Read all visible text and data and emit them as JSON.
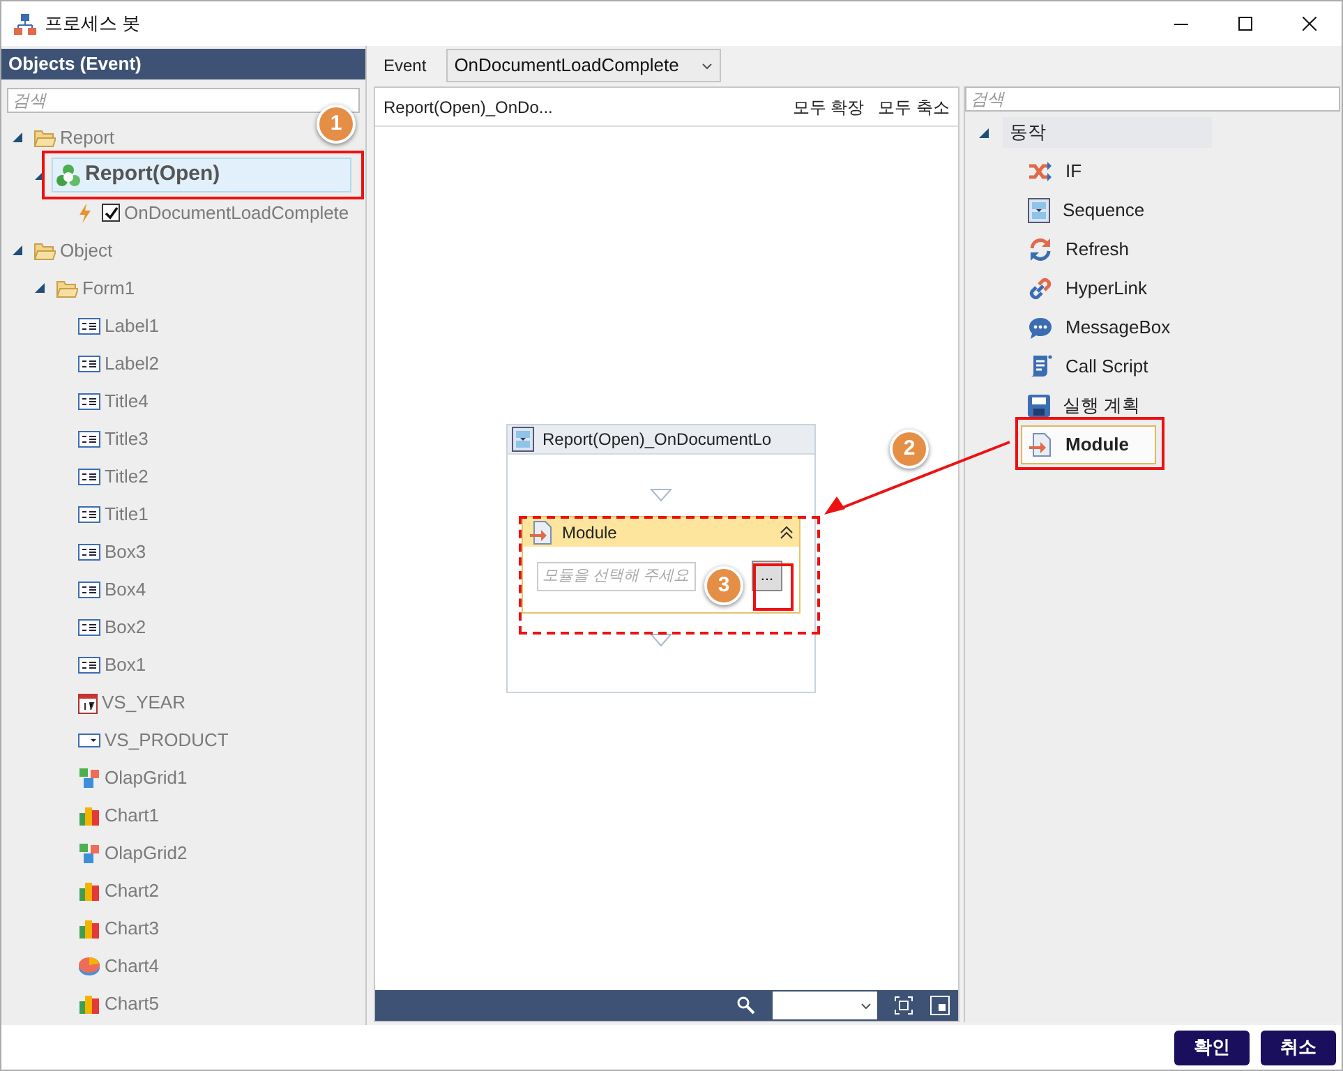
{
  "window": {
    "title": "프로세스 봇"
  },
  "objects_panel": {
    "title": "Objects (Event)",
    "search": {
      "placeholder": "검색"
    },
    "tree": [
      {
        "label": "Report",
        "kind": "folder",
        "expanded": true,
        "selected": false,
        "children": [
          {
            "label": "Report(Open)",
            "kind": "report",
            "expanded": true,
            "selected": true,
            "children": [
              {
                "label": "OnDocumentLoadComplete",
                "kind": "event",
                "checked": true,
                "selected": false
              }
            ]
          }
        ]
      },
      {
        "label": "Object",
        "kind": "folder",
        "expanded": true,
        "selected": false,
        "children": [
          {
            "label": "Form1",
            "kind": "folder",
            "expanded": true,
            "selected": false,
            "children": [
              {
                "label": "Label1",
                "kind": "label",
                "selected": false
              },
              {
                "label": "Label2",
                "kind": "label",
                "selected": false
              },
              {
                "label": "Title4",
                "kind": "label",
                "selected": false
              },
              {
                "label": "Title3",
                "kind": "label",
                "selected": false
              },
              {
                "label": "Title2",
                "kind": "label",
                "selected": false
              },
              {
                "label": "Title1",
                "kind": "label",
                "selected": false
              },
              {
                "label": "Box3",
                "kind": "label",
                "selected": false
              },
              {
                "label": "Box4",
                "kind": "label",
                "selected": false
              },
              {
                "label": "Box2",
                "kind": "label",
                "selected": false
              },
              {
                "label": "Box1",
                "kind": "label",
                "selected": false
              },
              {
                "label": "VS_YEAR",
                "kind": "calendar",
                "selected": false
              },
              {
                "label": "VS_PRODUCT",
                "kind": "combo",
                "selected": false
              },
              {
                "label": "OlapGrid1",
                "kind": "olap",
                "selected": false
              },
              {
                "label": "Chart1",
                "kind": "chart",
                "selected": false
              },
              {
                "label": "OlapGrid2",
                "kind": "olap",
                "selected": false
              },
              {
                "label": "Chart2",
                "kind": "chart",
                "selected": false
              },
              {
                "label": "Chart3",
                "kind": "chart",
                "selected": false
              },
              {
                "label": "Chart4",
                "kind": "pie",
                "selected": false
              },
              {
                "label": "Chart5",
                "kind": "chart",
                "selected": false
              }
            ]
          }
        ]
      }
    ]
  },
  "event_bar": {
    "label": "Event",
    "value": "OnDocumentLoadComplete"
  },
  "canvas": {
    "title": "Report(Open)_OnDo...",
    "actions": [
      "모두 확장",
      "모두 축소"
    ],
    "sequence": {
      "title": "Report(Open)_OnDocumentLo",
      "module": {
        "title": "Module",
        "placeholder": "모듈을 선택해 주세요",
        "button": "..."
      }
    }
  },
  "actions_panel": {
    "search": {
      "placeholder": "검색"
    },
    "group": {
      "label": "동작",
      "expanded": true
    },
    "items": [
      {
        "label": "IF",
        "kind": "if",
        "selected": false
      },
      {
        "label": "Sequence",
        "kind": "sequence",
        "selected": false
      },
      {
        "label": "Refresh",
        "kind": "refresh",
        "selected": false
      },
      {
        "label": "HyperLink",
        "kind": "link",
        "selected": false
      },
      {
        "label": "MessageBox",
        "kind": "message",
        "selected": false
      },
      {
        "label": "Call Script",
        "kind": "script",
        "selected": false
      },
      {
        "label": "실행 계획",
        "kind": "save",
        "selected": false
      },
      {
        "label": "Module",
        "kind": "module",
        "selected": true
      }
    ]
  },
  "annotations": [
    {
      "label": "1"
    },
    {
      "label": "2"
    },
    {
      "label": "3"
    }
  ],
  "buttons": [
    "확인",
    "취소"
  ]
}
